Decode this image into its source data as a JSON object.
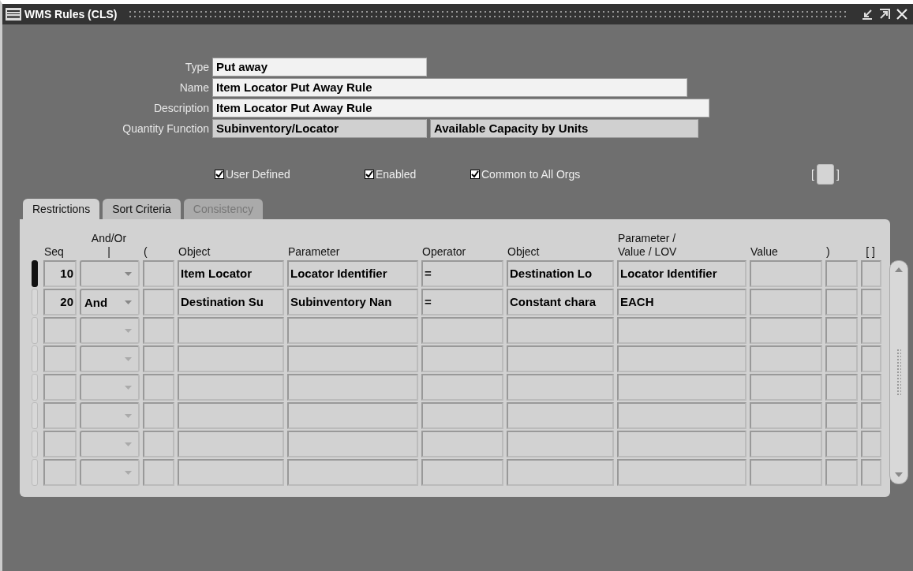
{
  "window": {
    "title": "WMS Rules (CLS)"
  },
  "form": [
    {
      "label": "Type",
      "value": "Put away",
      "kind": "short"
    },
    {
      "label": "Name",
      "value": "Item Locator Put Away Rule",
      "kind": "long"
    },
    {
      "label": "Description",
      "value": "Item Locator Put Away Rule",
      "kind": "longer"
    },
    {
      "label": "Quantity Function",
      "value": "Subinventory/Locator",
      "value_2": "Available Capacity by Units",
      "kind": "pair"
    }
  ],
  "checkboxes": [
    {
      "label": "User Defined",
      "checked": true
    },
    {
      "label": "Enabled",
      "checked": true
    },
    {
      "label": "Common to All Orgs",
      "checked": true
    }
  ],
  "bracket_button": {
    "left": "[",
    "right": "]"
  },
  "tabs": [
    {
      "label": "Restrictions",
      "selected": true,
      "disabled": false
    },
    {
      "label": "Sort Criteria",
      "selected": false,
      "disabled": false
    },
    {
      "label": "Consistency",
      "selected": false,
      "disabled": true
    }
  ],
  "table": {
    "columns": [
      {
        "label": "Seq"
      },
      {
        "label": "And/Or",
        "label_2": "|"
      },
      {
        "label": "("
      },
      {
        "label": "Object"
      },
      {
        "label": "Parameter"
      },
      {
        "label": "Operator"
      },
      {
        "label": "Object"
      },
      {
        "label": "Parameter /",
        "label_2": "Value / LOV"
      },
      {
        "label": "Value"
      },
      {
        "label": ")"
      },
      {
        "label": "[ ]"
      }
    ],
    "rows": [
      {
        "selected": true,
        "seq": "10",
        "object": "Item Locator",
        "parameter": "Locator Identifier",
        "operator": "=",
        "object_2": "Destination Lo",
        "parameter_value_lov": "Locator Identifier"
      },
      {
        "selected": false,
        "seq": "20",
        "and_or": "And",
        "object": "Destination Su",
        "parameter": "Subinventory Nan",
        "operator": "=",
        "object_2": "Constant chara",
        "parameter_value_lov": "EACH"
      },
      {
        "selected": false
      },
      {
        "selected": false
      },
      {
        "selected": false
      },
      {
        "selected": false
      },
      {
        "selected": false
      },
      {
        "selected": false
      }
    ]
  }
}
